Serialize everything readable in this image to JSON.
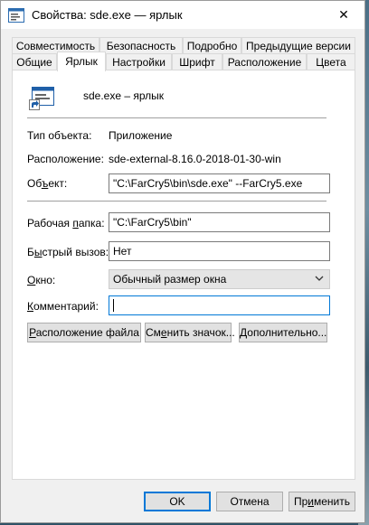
{
  "window": {
    "title": "Свойства: sde.exe — ярлык",
    "close_symbol": "✕"
  },
  "tabs": {
    "row1": [
      "Совместимость",
      "Безопасность",
      "Подробно",
      "Предыдущие версии"
    ],
    "row2": [
      "Общие",
      "Ярлык",
      "Настройки",
      "Шрифт",
      "Расположение",
      "Цвета"
    ],
    "active": "Ярлык"
  },
  "header": {
    "name": "sde.exe – ярлык",
    "icon": "shortcut-app-icon"
  },
  "info": {
    "type_label": "Тип объекта:",
    "type_value": "Приложение",
    "location_label": "Расположение:",
    "location_value": "sde-external-8.16.0-2018-01-30-win",
    "target_label_pre": "Об",
    "target_label_u": "ъ",
    "target_label_post": "ект:",
    "target_value": "\"C:\\FarCry5\\bin\\sde.exe\" --FarCry5.exe"
  },
  "fields": {
    "workdir_label_pre": "Рабочая ",
    "workdir_label_u": "п",
    "workdir_label_post": "апка:",
    "workdir_value": "\"C:\\FarCry5\\bin\"",
    "hotkey_label_pre": "Б",
    "hotkey_label_u": "ы",
    "hotkey_label_post": "стрый вызов:",
    "hotkey_value": "Нет",
    "window_label_pre": "",
    "window_label_u": "О",
    "window_label_post": "кно:",
    "window_value": "Обычный размер окна",
    "comment_label_pre": "",
    "comment_label_u": "К",
    "comment_label_post": "омментарий:",
    "comment_value": ""
  },
  "buttons": {
    "open_location_u": "Р",
    "open_location_post": "асположение файла",
    "change_icon_pre": "См",
    "change_icon_u": "е",
    "change_icon_post": "нить значок...",
    "advanced_u": "Д",
    "advanced_post": "ополнительно...",
    "ok": "OK",
    "cancel": "Отмена",
    "apply_pre": "Пр",
    "apply_u": "и",
    "apply_post": "менить"
  },
  "colors": {
    "accent": "#0078d7",
    "panel": "#ffffff",
    "dialog": "#f0f0f0"
  }
}
